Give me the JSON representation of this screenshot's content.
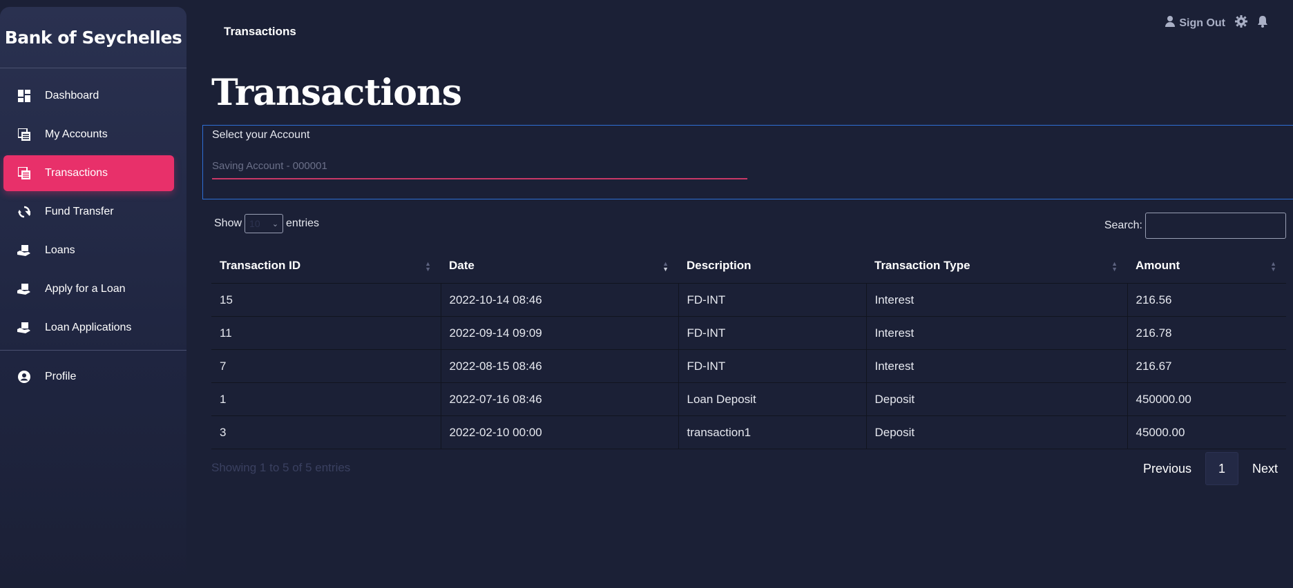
{
  "brand": "Bank of Seychelles",
  "sidebar": {
    "items": [
      {
        "label": "Dashboard",
        "icon": "dashboard-icon"
      },
      {
        "label": "My Accounts",
        "icon": "accounts-icon"
      },
      {
        "label": "Transactions",
        "icon": "transactions-icon"
      },
      {
        "label": "Fund Transfer",
        "icon": "transfer-icon"
      },
      {
        "label": "Loans",
        "icon": "loans-icon"
      },
      {
        "label": "Apply for a Loan",
        "icon": "apply-loan-icon"
      },
      {
        "label": "Loan Applications",
        "icon": "loan-applications-icon"
      }
    ],
    "profile": {
      "label": "Profile",
      "icon": "profile-icon"
    },
    "active_index": 2
  },
  "topbar": {
    "title": "Transactions",
    "sign_out": "Sign Out"
  },
  "page": {
    "title": "Transactions",
    "account_label": "Select your Account",
    "account_value": "Saving Account - 000001"
  },
  "table_controls": {
    "show": "Show",
    "entries_value": "10",
    "entries": "entries",
    "search_label": "Search:"
  },
  "table": {
    "headers": [
      "Transaction ID",
      "Date",
      "Description",
      "Transaction Type",
      "Amount"
    ],
    "rows": [
      [
        "15",
        "2022-10-14 08:46",
        "FD-INT",
        "Interest",
        "216.56"
      ],
      [
        "11",
        "2022-09-14 09:09",
        "FD-INT",
        "Interest",
        "216.78"
      ],
      [
        "7",
        "2022-08-15 08:46",
        "FD-INT",
        "Interest",
        "216.67"
      ],
      [
        "1",
        "2022-07-16 08:46",
        "Loan Deposit",
        "Deposit",
        "450000.00"
      ],
      [
        "3",
        "2022-02-10 00:00",
        "transaction1",
        "Deposit",
        "45000.00"
      ]
    ]
  },
  "footer": {
    "info": "Showing 1 to 5 of 5 entries",
    "previous": "Previous",
    "page": "1",
    "next": "Next"
  },
  "colors": {
    "background": "#1b2036",
    "accent": "#e8306a",
    "focus_border": "#2e6fd6"
  }
}
